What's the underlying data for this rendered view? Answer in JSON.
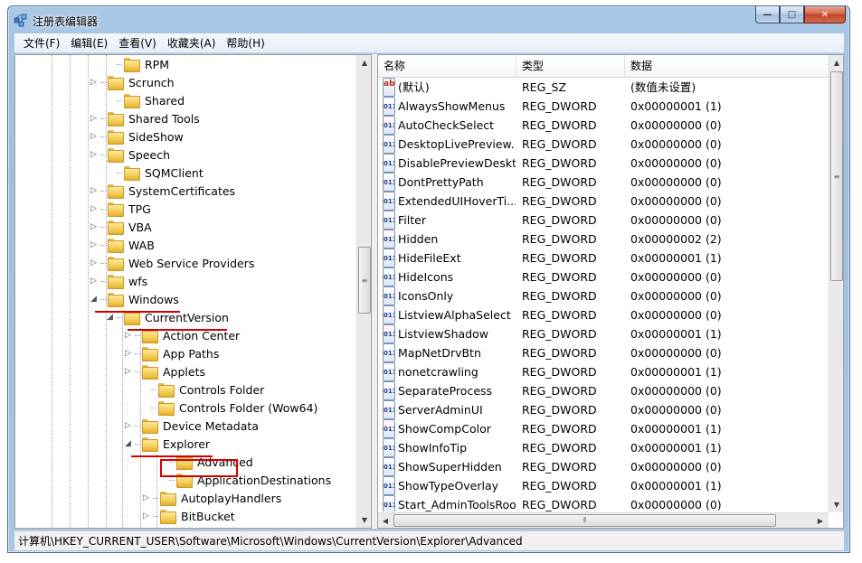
{
  "window": {
    "title": "注册表编辑器",
    "buttons": {
      "minimize": "—",
      "maximize": "□",
      "close": "✕"
    }
  },
  "menu": [
    "文件(F)",
    "编辑(E)",
    "查看(V)",
    "收藏夹(A)",
    "帮助(H)"
  ],
  "tree": {
    "items": [
      {
        "label": "RPM",
        "expander": ""
      },
      {
        "label": "Scrunch",
        "expander": "▷"
      },
      {
        "label": "Shared",
        "expander": ""
      },
      {
        "label": "Shared Tools",
        "expander": "▷"
      },
      {
        "label": "SideShow",
        "expander": "▷"
      },
      {
        "label": "Speech",
        "expander": "▷"
      },
      {
        "label": "SQMClient",
        "expander": ""
      },
      {
        "label": "SystemCertificates",
        "expander": "▷"
      },
      {
        "label": "TPG",
        "expander": "▷"
      },
      {
        "label": "VBA",
        "expander": "▷"
      },
      {
        "label": "WAB",
        "expander": "▷"
      },
      {
        "label": "Web Service Providers",
        "expander": "▷"
      },
      {
        "label": "wfs",
        "expander": "▷"
      },
      {
        "label": "Windows",
        "expander": "◢"
      },
      {
        "label": "CurrentVersion",
        "expander": "◢"
      },
      {
        "label": "Action Center",
        "expander": "▷"
      },
      {
        "label": "App Paths",
        "expander": "▷"
      },
      {
        "label": "Applets",
        "expander": "▷"
      },
      {
        "label": "Controls Folder",
        "expander": ""
      },
      {
        "label": "Controls Folder (Wow64)",
        "expander": ""
      },
      {
        "label": "Device Metadata",
        "expander": "▷"
      },
      {
        "label": "Explorer",
        "expander": "◢"
      },
      {
        "label": "Advanced",
        "expander": ""
      },
      {
        "label": "ApplicationDestinations",
        "expander": ""
      },
      {
        "label": "AutoplayHandlers",
        "expander": "▷"
      },
      {
        "label": "BitBucket",
        "expander": "▷"
      }
    ]
  },
  "list": {
    "columns": [
      "名称",
      "类型",
      "数据"
    ],
    "rows": [
      {
        "name": "(默认)",
        "type": "REG_SZ",
        "data": "(数值未设置)",
        "icon": "ab"
      },
      {
        "name": "AlwaysShowMenus",
        "type": "REG_DWORD",
        "data": "0x00000001 (1)",
        "icon": "dword"
      },
      {
        "name": "AutoCheckSelect",
        "type": "REG_DWORD",
        "data": "0x00000000 (0)",
        "icon": "dword"
      },
      {
        "name": "DesktopLivePreview...",
        "type": "REG_DWORD",
        "data": "0x00000000 (0)",
        "icon": "dword"
      },
      {
        "name": "DisablePreviewDeskt...",
        "type": "REG_DWORD",
        "data": "0x00000000 (0)",
        "icon": "dword"
      },
      {
        "name": "DontPrettyPath",
        "type": "REG_DWORD",
        "data": "0x00000000 (0)",
        "icon": "dword"
      },
      {
        "name": "ExtendedUIHoverTi...",
        "type": "REG_DWORD",
        "data": "0x00000000 (0)",
        "icon": "dword"
      },
      {
        "name": "Filter",
        "type": "REG_DWORD",
        "data": "0x00000000 (0)",
        "icon": "dword"
      },
      {
        "name": "Hidden",
        "type": "REG_DWORD",
        "data": "0x00000002 (2)",
        "icon": "dword"
      },
      {
        "name": "HideFileExt",
        "type": "REG_DWORD",
        "data": "0x00000001 (1)",
        "icon": "dword"
      },
      {
        "name": "HideIcons",
        "type": "REG_DWORD",
        "data": "0x00000000 (0)",
        "icon": "dword"
      },
      {
        "name": "IconsOnly",
        "type": "REG_DWORD",
        "data": "0x00000000 (0)",
        "icon": "dword"
      },
      {
        "name": "ListviewAlphaSelect",
        "type": "REG_DWORD",
        "data": "0x00000000 (0)",
        "icon": "dword"
      },
      {
        "name": "ListviewShadow",
        "type": "REG_DWORD",
        "data": "0x00000001 (1)",
        "icon": "dword"
      },
      {
        "name": "MapNetDrvBtn",
        "type": "REG_DWORD",
        "data": "0x00000000 (0)",
        "icon": "dword"
      },
      {
        "name": "nonetcrawling",
        "type": "REG_DWORD",
        "data": "0x00000001 (1)",
        "icon": "dword"
      },
      {
        "name": "SeparateProcess",
        "type": "REG_DWORD",
        "data": "0x00000000 (0)",
        "icon": "dword"
      },
      {
        "name": "ServerAdminUI",
        "type": "REG_DWORD",
        "data": "0x00000000 (0)",
        "icon": "dword"
      },
      {
        "name": "ShowCompColor",
        "type": "REG_DWORD",
        "data": "0x00000001 (1)",
        "icon": "dword"
      },
      {
        "name": "ShowInfoTip",
        "type": "REG_DWORD",
        "data": "0x00000001 (1)",
        "icon": "dword"
      },
      {
        "name": "ShowSuperHidden",
        "type": "REG_DWORD",
        "data": "0x00000000 (0)",
        "icon": "dword"
      },
      {
        "name": "ShowTypeOverlay",
        "type": "REG_DWORD",
        "data": "0x00000001 (1)",
        "icon": "dword"
      },
      {
        "name": "Start_AdminToolsRoot",
        "type": "REG_DWORD",
        "data": "0x00000000 (0)",
        "icon": "dword"
      }
    ]
  },
  "status": {
    "path": "计算机\\HKEY_CURRENT_USER\\Software\\Microsoft\\Windows\\CurrentVersion\\Explorer\\Advanced"
  },
  "colors": {
    "highlight_red": "#d40000",
    "titlebar": "#a9c7e6"
  }
}
